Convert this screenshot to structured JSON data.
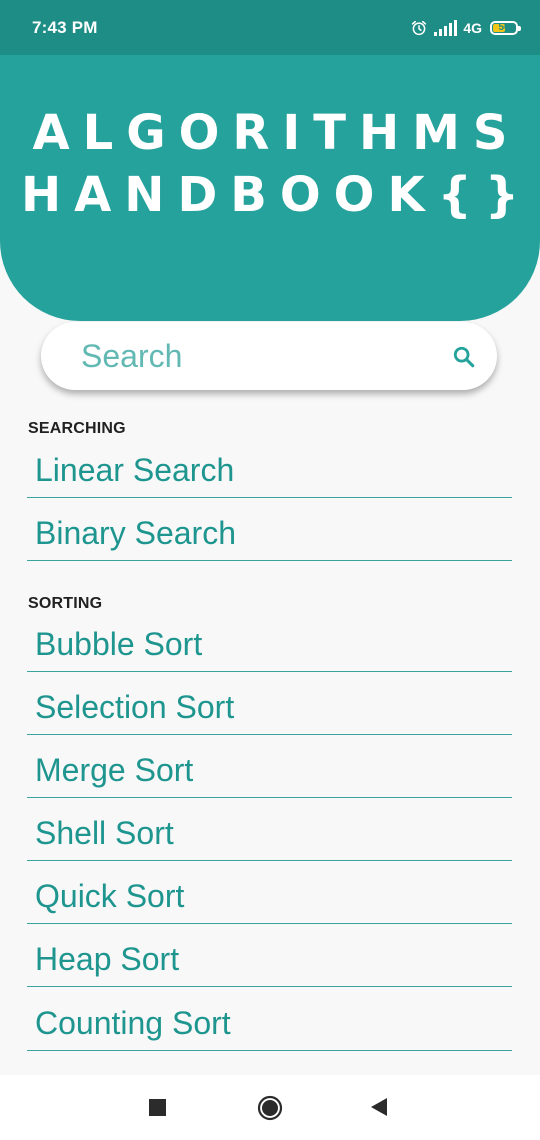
{
  "status_bar": {
    "time": "7:43 PM",
    "network": "4G",
    "battery": "50",
    "battery_level": 0.5
  },
  "header": {
    "title_line1": "ALGORITHMS",
    "title_line2": "HANDBOOK{}"
  },
  "search": {
    "placeholder": "Search",
    "value": ""
  },
  "sections": {
    "searching": {
      "label": "SEARCHING",
      "items": [
        "Linear Search",
        "Binary Search"
      ]
    },
    "sorting": {
      "label": "SORTING",
      "items": [
        "Bubble Sort",
        "Selection Sort",
        "Merge Sort",
        "Shell Sort",
        "Quick Sort",
        "Heap Sort",
        "Counting Sort"
      ]
    }
  },
  "colors": {
    "status_bar": "#1e8d86",
    "header": "#26a29c",
    "accent_text": "#1e968f",
    "divider": "#3aa39d",
    "background": "#f8f8f8"
  },
  "icons": {
    "search": "search-icon",
    "alarm": "alarm-icon",
    "signal": "signal-icon",
    "battery": "battery-icon",
    "nav_recents": "recents-icon",
    "nav_home": "home-icon",
    "nav_back": "back-icon"
  }
}
